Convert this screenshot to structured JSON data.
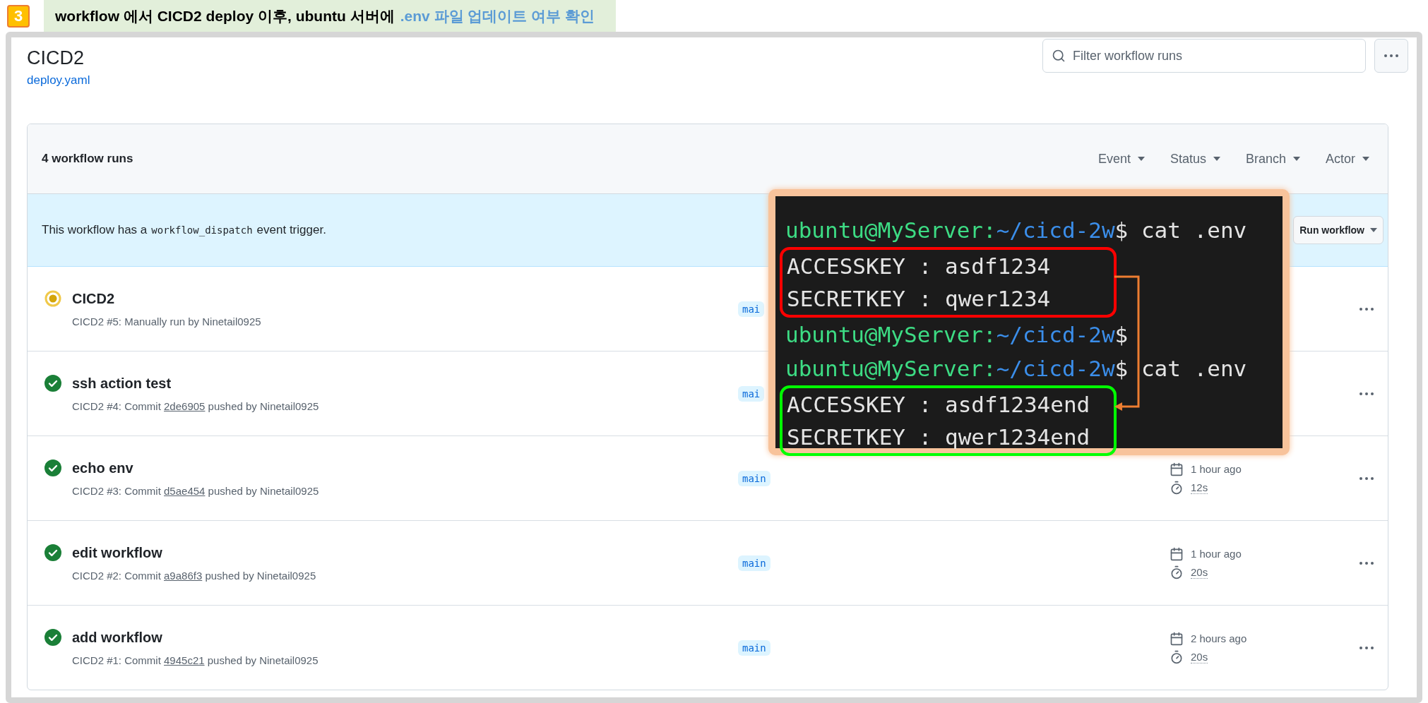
{
  "annotation": {
    "step": "3",
    "text": "workflow 에서 CICD2 deploy 이후, ubuntu 서버에",
    "highlight": ".env 파일 업데이트 여부 확인"
  },
  "workflow": {
    "title": "CICD2",
    "file": "deploy.yaml"
  },
  "search": {
    "placeholder": "Filter workflow runs"
  },
  "runs_header": {
    "count": "4 workflow runs",
    "filters": [
      "Event",
      "Status",
      "Branch",
      "Actor"
    ]
  },
  "dispatch_notice": {
    "before": "This workflow has a",
    "code": "workflow_dispatch",
    "after": "event trigger.",
    "button": "Run workflow"
  },
  "runs": [
    {
      "kind": "in_progress",
      "title": "CICD2",
      "meta": {
        "before": "CICD2 #5: Manually run by Ninetail0925"
      },
      "branch": "mai"
    },
    {
      "kind": "success",
      "title": "ssh action test",
      "meta": {
        "before": "CICD2 #4: Commit",
        "commit": "2de6905",
        "after": "pushed by Ninetail0925"
      },
      "branch": "mai"
    },
    {
      "kind": "success",
      "title": "echo env",
      "meta": {
        "before": "CICD2 #3: Commit",
        "commit": "d5ae454",
        "after": "pushed by Ninetail0925"
      },
      "branch": "main",
      "age": "1 hour ago",
      "duration": "12s"
    },
    {
      "kind": "success",
      "title": "edit workflow",
      "meta": {
        "before": "CICD2 #2: Commit",
        "commit": "a9a86f3",
        "after": "pushed by Ninetail0925"
      },
      "branch": "main",
      "age": "1 hour ago",
      "duration": "20s"
    },
    {
      "kind": "success",
      "title": "add workflow",
      "meta": {
        "before": "CICD2 #1: Commit",
        "commit": "4945c21",
        "after": "pushed by Ninetail0925"
      },
      "branch": "main",
      "age": "2 hours ago",
      "duration": "20s"
    }
  ],
  "terminal": {
    "lines": [
      {
        "kind": "prompt",
        "user": "ubuntu@MyServer:",
        "path": "~/cicd-2w",
        "command": "$ cat .env"
      },
      {
        "kind": "box",
        "color": "#ff0000",
        "lines": [
          "ACCESSKEY : asdf1234",
          "SECRETKEY : qwer1234"
        ]
      },
      {
        "kind": "prompt",
        "user": "ubuntu@MyServer:",
        "path": "~/cicd-2w",
        "command": "$"
      },
      {
        "kind": "prompt",
        "user": "ubuntu@MyServer:",
        "path": "~/cicd-2w",
        "command": "$ cat .env"
      },
      {
        "kind": "box",
        "color": "#00ff00",
        "lines": [
          "ACCESSKEY : asdf1234end",
          "SECRETKEY : qwer1234end"
        ]
      }
    ]
  }
}
